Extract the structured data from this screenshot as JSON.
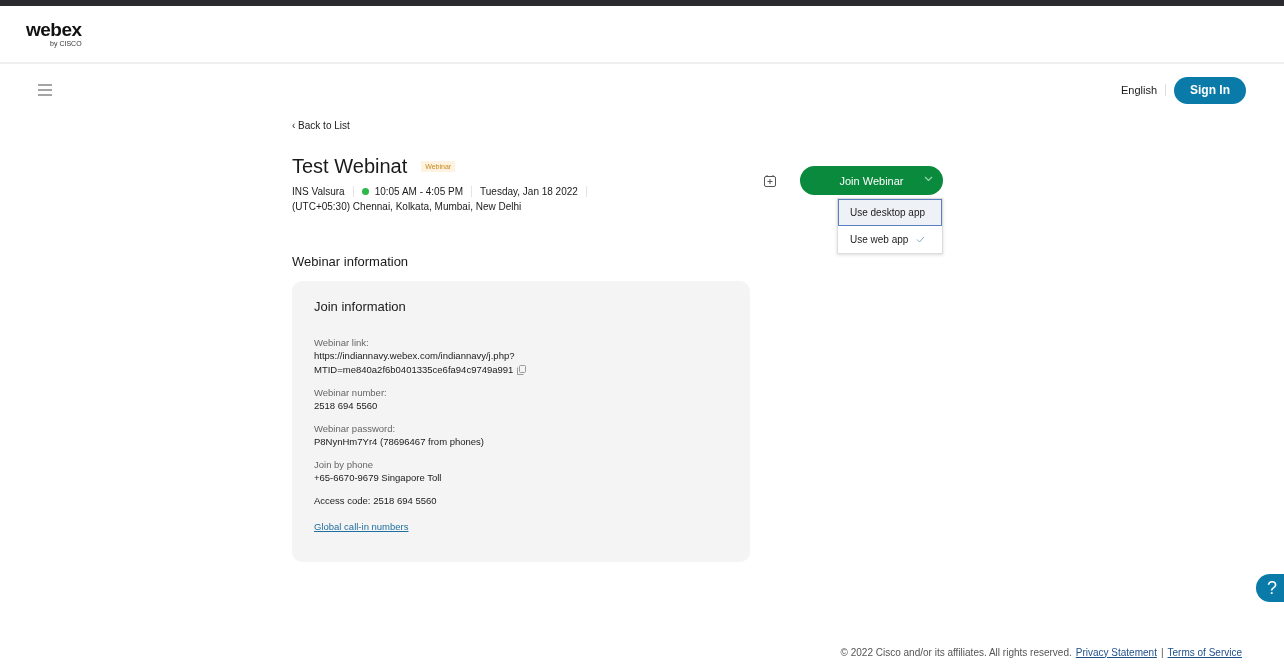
{
  "header": {
    "logo": "webex",
    "logo_sub": "by CISCO"
  },
  "nav": {
    "language": "English",
    "sign_in": "Sign In"
  },
  "back_link": "‹ Back to List",
  "meeting": {
    "title": "Test Webinat",
    "badge": "Webinar",
    "host": "INS Valsura",
    "live": true,
    "time": "10:05 AM - 4:05 PM",
    "date": "Tuesday, Jan 18 2022",
    "timezone": "(UTC+05:30) Chennai, Kolkata, Mumbai, New Delhi"
  },
  "join_button": {
    "label": "Join Webinar",
    "expanded": true
  },
  "join_menu": [
    {
      "label": "Use desktop app",
      "selected": true,
      "checked": false
    },
    {
      "label": "Use web app",
      "selected": false,
      "checked": true
    }
  ],
  "section_title": "Webinar information",
  "card": {
    "title": "Join information",
    "fields": [
      {
        "kind": "link",
        "label": "Webinar link:",
        "lines": [
          "https://indiannavy.webex.com/indiannavy/j.php?",
          "MTID=me840a2f6b0401335ce6fa94c9749a991"
        ]
      },
      {
        "kind": "plain",
        "label": "Webinar number:",
        "lines": [
          "2518 694 5560"
        ]
      },
      {
        "kind": "plain",
        "label": "Webinar password:",
        "lines": [
          "P8NynHm7Yr4 (78696467 from phones)"
        ]
      },
      {
        "kind": "plain",
        "label": "Join by phone",
        "lines": [
          "+65-6670-9679 Singapore Toll"
        ]
      },
      {
        "kind": "plain",
        "lines": [
          "Access code: 2518 694 5560"
        ]
      }
    ],
    "link": "Global call-in numbers"
  },
  "help": "?",
  "footer": {
    "copyright": "© 2022 Cisco and/or its affiliates. All rights reserved.",
    "links": [
      "Privacy Statement",
      "Terms of Service"
    ],
    "separator": "|"
  }
}
